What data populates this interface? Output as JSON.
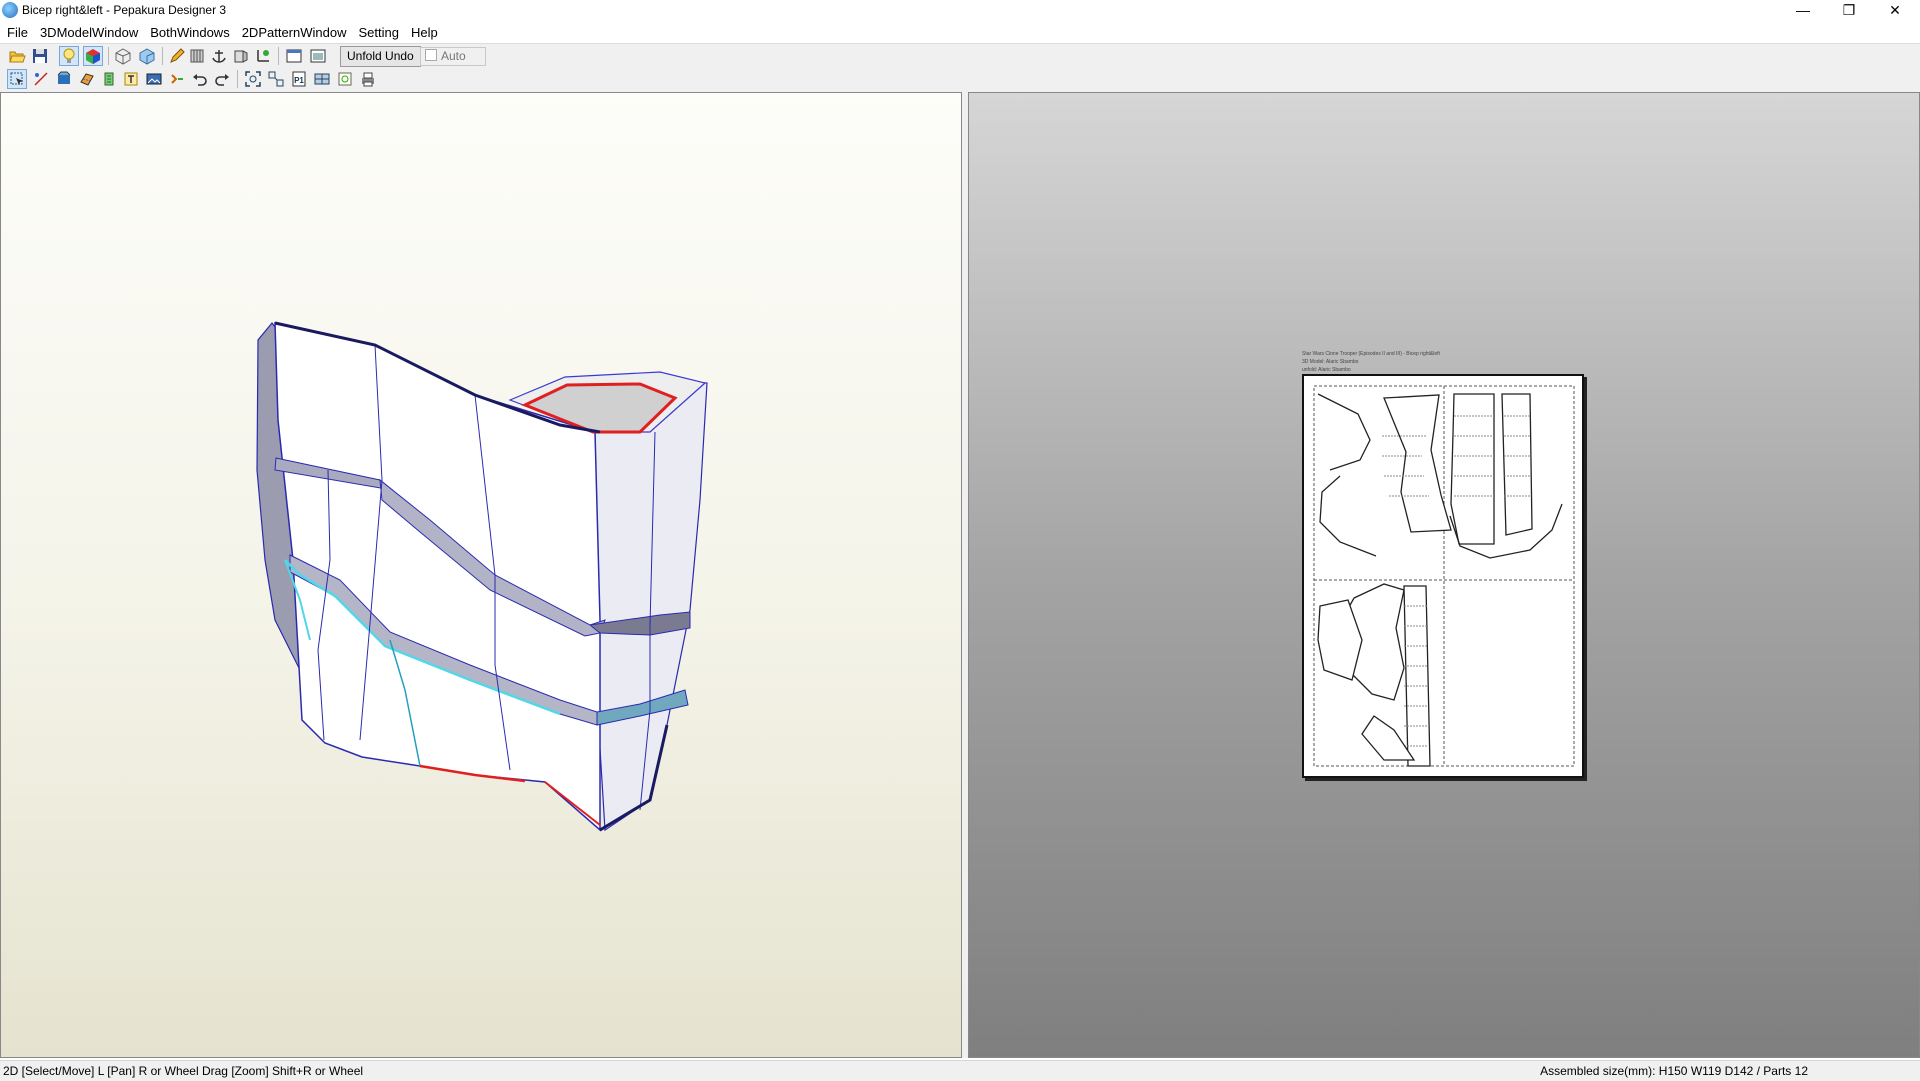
{
  "window": {
    "title": "Bicep right&left - Pepakura Designer 3",
    "min_glyph": "—",
    "max_glyph": "❐",
    "close_glyph": "✕"
  },
  "menu": [
    "File",
    "3DModelWindow",
    "BothWindows",
    "2DPatternWindow",
    "Setting",
    "Help"
  ],
  "toolbar1": {
    "icons": [
      "open-icon",
      "save-icon",
      "lightbulb-icon",
      "color-cube-icon",
      "cube-icon",
      "cube-shaded-icon",
      "pencil-icon",
      "texture-icon",
      "anchor-icon",
      "flap-icon",
      "axes-icon",
      "window-single-icon",
      "window-split-icon"
    ],
    "unfold_undo_label": "Unfold Undo",
    "auto_label": "Auto"
  },
  "toolbar2": {
    "icons": [
      "select-icon",
      "edge-edit-icon",
      "flaps-icon",
      "fold-lines-icon",
      "rotate-part-icon",
      "text-tool-icon",
      "image-tool-icon",
      "join-icon",
      "undo-icon",
      "redo-icon",
      "zoom-fit-icon",
      "arrange-icon",
      "page-number-icon",
      "layout-icon",
      "print-preview-icon",
      "print-icon"
    ]
  },
  "pattern_page": {
    "header_lines": [
      "Star Wars Clone Trooper (Episodes II and III) - Bicep right&left",
      "3D Model: Alaric Sbambo",
      "unfold: Alaric Sbambo"
    ]
  },
  "status": {
    "left": "2D [Select/Move] L [Pan] R or Wheel Drag [Zoom] Shift+R or Wheel",
    "right": "Assembled size(mm): H150 W119 D142 / Parts 12"
  }
}
